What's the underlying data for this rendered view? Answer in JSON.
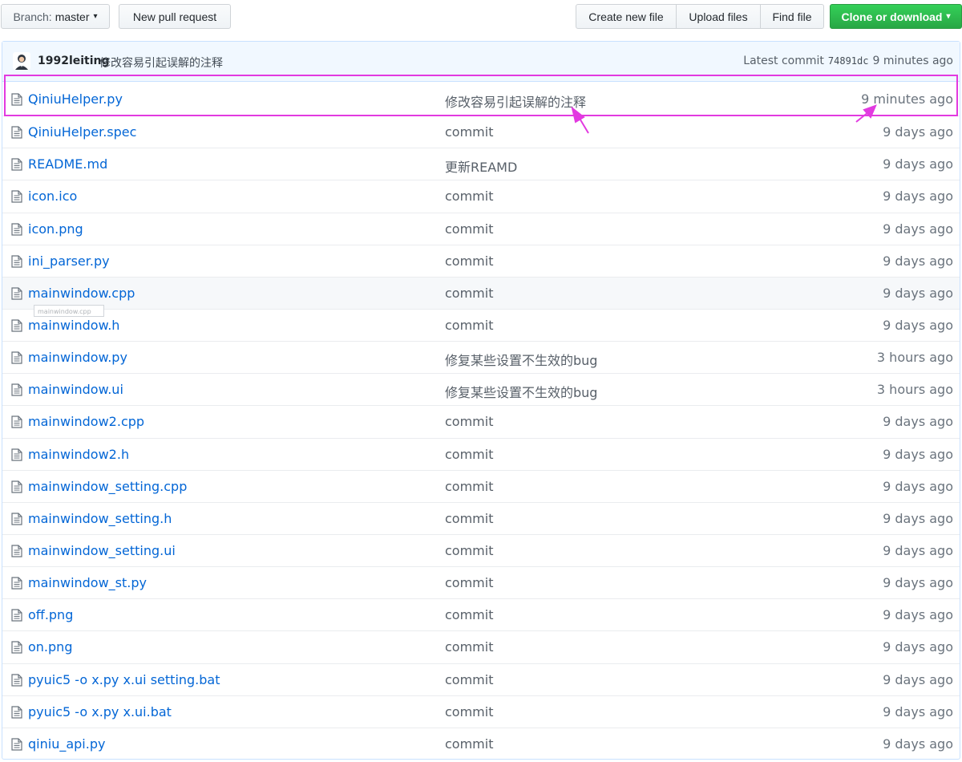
{
  "toolbar": {
    "branch_prefix": "Branch:",
    "branch_name": "master",
    "branch_caret": "▾",
    "new_pull_request": "New pull request",
    "create_new_file": "Create new file",
    "upload_files": "Upload files",
    "find_file": "Find file",
    "clone_or_download": "Clone or download",
    "clone_caret": "▾"
  },
  "latest_commit": {
    "author": "1992leiting",
    "message": "修改容易引起误解的注释",
    "label": "Latest commit",
    "sha": "74891dc",
    "age": "9 minutes ago"
  },
  "files": [
    {
      "name": "QiniuHelper.py",
      "message": "修改容易引起误解的注释",
      "age": "9 minutes ago"
    },
    {
      "name": "QiniuHelper.spec",
      "message": "commit",
      "age": "9 days ago"
    },
    {
      "name": "README.md",
      "message": "更新REAMD",
      "age": "9 days ago"
    },
    {
      "name": "icon.ico",
      "message": "commit",
      "age": "9 days ago"
    },
    {
      "name": "icon.png",
      "message": "commit",
      "age": "9 days ago"
    },
    {
      "name": "ini_parser.py",
      "message": "commit",
      "age": "9 days ago"
    },
    {
      "name": "mainwindow.cpp",
      "message": "commit",
      "age": "9 days ago"
    },
    {
      "name": "mainwindow.h",
      "message": "commit",
      "age": "9 days ago"
    },
    {
      "name": "mainwindow.py",
      "message": "修复某些设置不生效的bug",
      "age": "3 hours ago"
    },
    {
      "name": "mainwindow.ui",
      "message": "修复某些设置不生效的bug",
      "age": "3 hours ago"
    },
    {
      "name": "mainwindow2.cpp",
      "message": "commit",
      "age": "9 days ago"
    },
    {
      "name": "mainwindow2.h",
      "message": "commit",
      "age": "9 days ago"
    },
    {
      "name": "mainwindow_setting.cpp",
      "message": "commit",
      "age": "9 days ago"
    },
    {
      "name": "mainwindow_setting.h",
      "message": "commit",
      "age": "9 days ago"
    },
    {
      "name": "mainwindow_setting.ui",
      "message": "commit",
      "age": "9 days ago"
    },
    {
      "name": "mainwindow_st.py",
      "message": "commit",
      "age": "9 days ago"
    },
    {
      "name": "off.png",
      "message": "commit",
      "age": "9 days ago"
    },
    {
      "name": "on.png",
      "message": "commit",
      "age": "9 days ago"
    },
    {
      "name": "pyuic5 -o x.py x.ui setting.bat",
      "message": "commit",
      "age": "9 days ago"
    },
    {
      "name": "pyuic5 -o x.py x.ui.bat",
      "message": "commit",
      "age": "9 days ago"
    },
    {
      "name": "qiniu_api.py",
      "message": "commit",
      "age": "9 days ago"
    }
  ],
  "hovered_row_index": 6,
  "tooltip_text": "mainwindow.cpp",
  "icons": {
    "file": "file-icon",
    "avatar": "avatar-image"
  },
  "colors": {
    "link": "#0366d6",
    "clone_button": "#28a745",
    "commit_bar": "#f1f8ff",
    "annotation": "#e23ae0"
  }
}
